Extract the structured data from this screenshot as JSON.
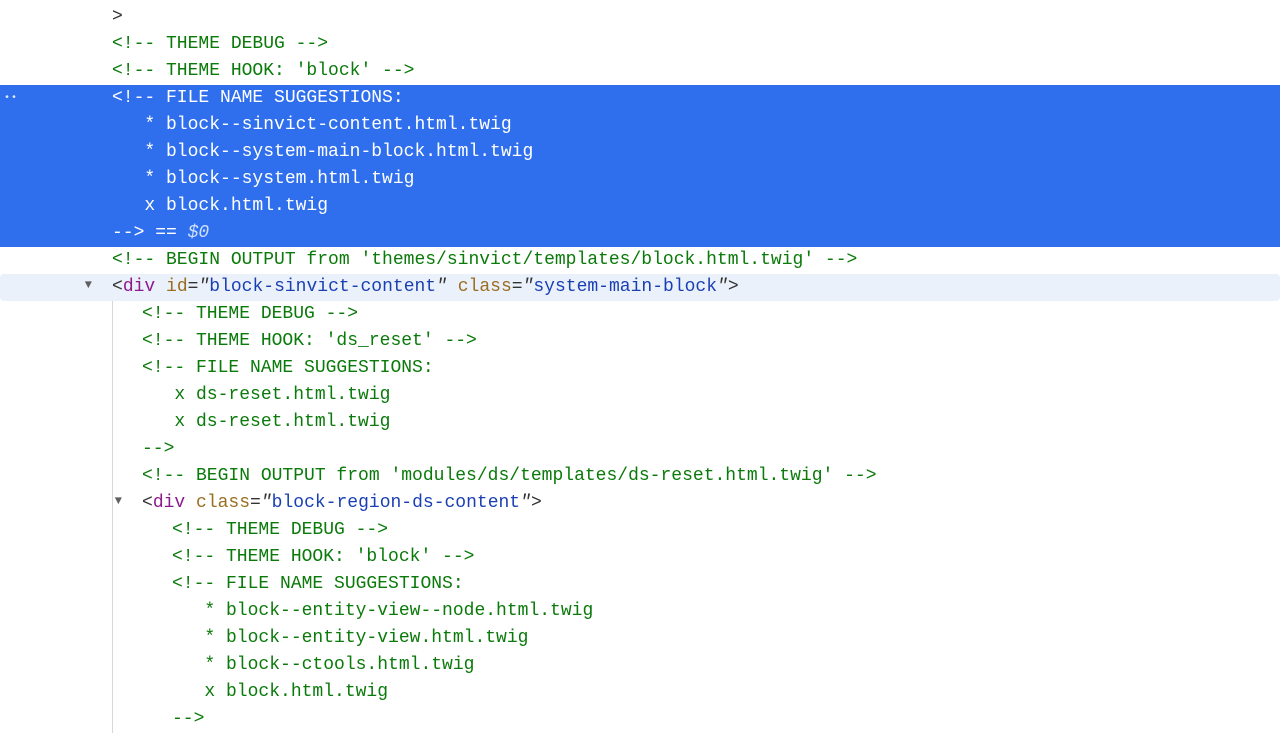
{
  "lines": {
    "l0": ">",
    "l1": "<!-- THEME DEBUG -->",
    "l2": "<!-- THEME HOOK: 'block' -->",
    "l3a": "<!-- FILE NAME SUGGESTIONS:",
    "l3s1": "   * block--sinvict-content.html.twig",
    "l3s2": "   * block--system-main-block.html.twig",
    "l3s3": "   * block--system.html.twig",
    "l3s4": "   x block.html.twig",
    "l3end": "-->",
    "l3eq": " == ",
    "l3dollar": "$0",
    "l5": "<!-- BEGIN OUTPUT from 'themes/sinvict/templates/block.html.twig' -->",
    "div1_tag": "div",
    "div1_idname": "id",
    "div1_idval": "block-sinvict-content",
    "div1_classname": "class",
    "div1_classval": "system-main-block",
    "l7": "<!-- THEME DEBUG -->",
    "l8": "<!-- THEME HOOK: 'ds_reset' -->",
    "l9a": "<!-- FILE NAME SUGGESTIONS:",
    "l9s1": "   x ds-reset.html.twig",
    "l9s2": "   x ds-reset.html.twig",
    "l9end": "-->",
    "l10": "<!-- BEGIN OUTPUT from 'modules/ds/templates/ds-reset.html.twig' -->",
    "div2_tag": "div",
    "div2_classname": "class",
    "div2_classval": "block-region-ds-content",
    "l12": "<!-- THEME DEBUG -->",
    "l13": "<!-- THEME HOOK: 'block' -->",
    "l14a": "<!-- FILE NAME SUGGESTIONS:",
    "l14s1": "   * block--entity-view--node.html.twig",
    "l14s2": "   * block--entity-view.html.twig",
    "l14s3": "   * block--ctools.html.twig",
    "l14s4": "   x block.html.twig",
    "l14end": "-->"
  },
  "ellipsis": "••"
}
